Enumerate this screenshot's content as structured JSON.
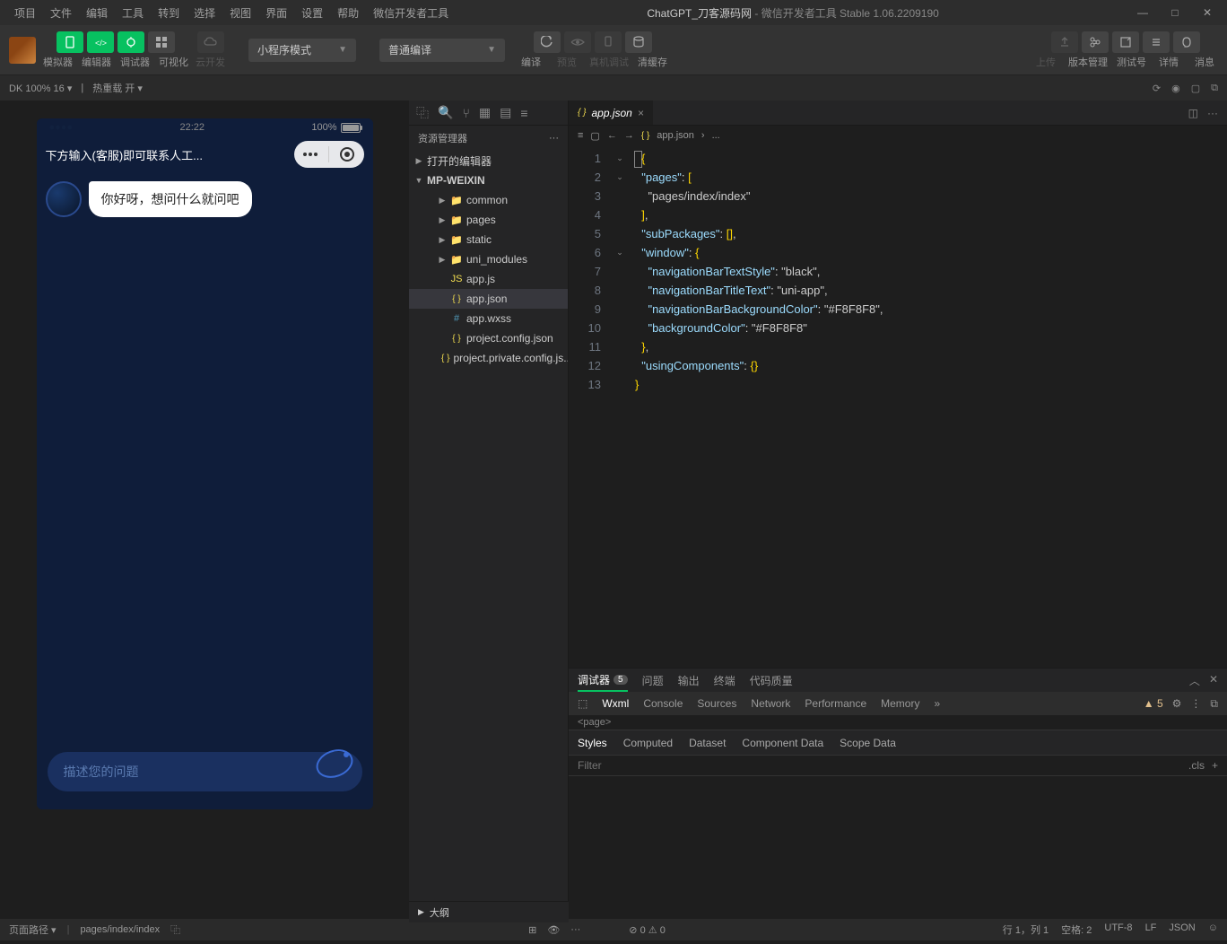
{
  "title": {
    "project": "ChatGPT_刀客源码网",
    "suffix": " - 微信开发者工具 Stable 1.06.2209190"
  },
  "menu": [
    "项目",
    "文件",
    "编辑",
    "工具",
    "转到",
    "选择",
    "视图",
    "界面",
    "设置",
    "帮助",
    "微信开发者工具"
  ],
  "toolbar": {
    "row1_labels": [
      "模拟器",
      "编辑器",
      "调试器",
      "可视化"
    ],
    "cloud": "云开发",
    "mode": "小程序模式",
    "compile": "普通编译",
    "center_labels": [
      "编译",
      "预览",
      "真机调试",
      "清缓存"
    ],
    "right_labels": [
      "上传",
      "版本管理",
      "测试号",
      "详情",
      "消息"
    ]
  },
  "secondbar": {
    "device": "DK 100% 16",
    "hot": "热重载 开"
  },
  "simulator": {
    "time": "22:22",
    "battery": "100%",
    "nav_title": "下方输入(客服)即可联系人工...",
    "chat_msg": "你好呀，想问什么就问吧",
    "input_placeholder": "描述您的问题"
  },
  "explorer": {
    "title": "资源管理器",
    "sections": {
      "open_editors": "打开的编辑器",
      "project": "MP-WEIXIN",
      "outline": "大纲"
    },
    "tree": [
      {
        "name": "common",
        "type": "folder",
        "indent": 2,
        "expand": "▶"
      },
      {
        "name": "pages",
        "type": "folder-red",
        "indent": 2,
        "expand": "▶"
      },
      {
        "name": "static",
        "type": "folder",
        "indent": 2,
        "expand": "▶"
      },
      {
        "name": "uni_modules",
        "type": "folder",
        "indent": 2,
        "expand": "▶"
      },
      {
        "name": "app.js",
        "type": "js",
        "indent": 2
      },
      {
        "name": "app.json",
        "type": "json",
        "indent": 2,
        "active": true
      },
      {
        "name": "app.wxss",
        "type": "css",
        "indent": 2
      },
      {
        "name": "project.config.json",
        "type": "json",
        "indent": 2
      },
      {
        "name": "project.private.config.js...",
        "type": "json",
        "indent": 2
      }
    ]
  },
  "editor": {
    "tab_name": "app.json",
    "breadcrumb": [
      "app.json",
      "..."
    ],
    "code_lines": [
      "{",
      "  \"pages\": [",
      "    \"pages/index/index\"",
      "  ],",
      "  \"subPackages\": [],",
      "  \"window\": {",
      "    \"navigationBarTextStyle\": \"black\",",
      "    \"navigationBarTitleText\": \"uni-app\",",
      "    \"navigationBarBackgroundColor\": \"#F8F8F8\",",
      "    \"backgroundColor\": \"#F8F8F8\"",
      "  },",
      "  \"usingComponents\": {}",
      "}"
    ]
  },
  "devtools": {
    "tabs1": [
      {
        "label": "调试器",
        "badge": "5",
        "active": true
      },
      {
        "label": "问题"
      },
      {
        "label": "输出"
      },
      {
        "label": "终端"
      },
      {
        "label": "代码质量"
      }
    ],
    "tabs2": [
      "Wxml",
      "Console",
      "Sources",
      "Network",
      "Performance",
      "Memory"
    ],
    "warn_count": "5",
    "page_tag": "<page>",
    "styles_tabs": [
      "Styles",
      "Computed",
      "Dataset",
      "Component Data",
      "Scope Data"
    ],
    "filter_placeholder": "Filter",
    "cls": ".cls"
  },
  "statusbar": {
    "left": [
      "页面路径",
      "pages/index/index"
    ],
    "errors": "0",
    "warnings": "0",
    "right": [
      "行 1，列 1",
      "空格: 2",
      "UTF-8",
      "LF",
      "JSON"
    ]
  }
}
